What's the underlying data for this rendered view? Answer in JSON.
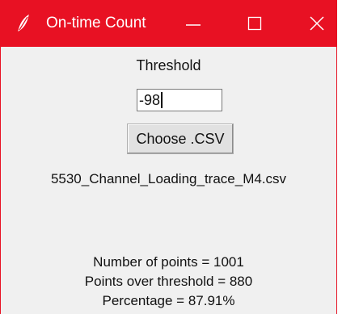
{
  "window": {
    "title": "On-time Count",
    "accent_color": "#e81123",
    "icon": "feather-icon",
    "controls": {
      "minimize_icon": "minimize-icon",
      "maximize_icon": "maximize-icon",
      "close_icon": "close-icon"
    }
  },
  "form": {
    "threshold_label": "Threshold",
    "threshold_value": "-98",
    "choose_button_label": "Choose .CSV",
    "selected_file": "5530_Channel_Loading_trace_M4.csv"
  },
  "results": {
    "points_line": "Number of points = 1001",
    "over_threshold_line": "Points over threshold = 880",
    "percentage_line": "Percentage = 87.91%"
  }
}
